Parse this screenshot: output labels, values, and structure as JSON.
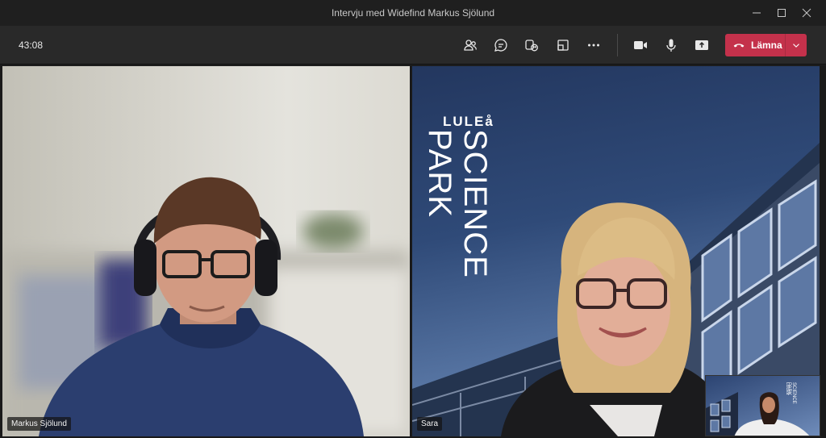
{
  "window": {
    "title": "Intervju med Widefind Markus Sjölund"
  },
  "toolbar": {
    "timer": "43:08",
    "icons": [
      "people-icon",
      "chat-icon",
      "reactions-icon",
      "share-tray-icon",
      "more-icon",
      "camera-icon",
      "microphone-icon",
      "share-screen-icon"
    ],
    "leave_label": "Lämna",
    "leave_color": "#c4314b"
  },
  "participants": [
    {
      "name": "Markus Sjölund"
    },
    {
      "name": "Sara"
    }
  ],
  "background": {
    "logo_top": "LULEå",
    "logo_line1": "SCIENCE",
    "logo_line2": "PARK"
  },
  "self_view": {
    "logo_top": "LULEå",
    "logo_line1": "SCIENCE",
    "logo_line2": "PARK"
  }
}
